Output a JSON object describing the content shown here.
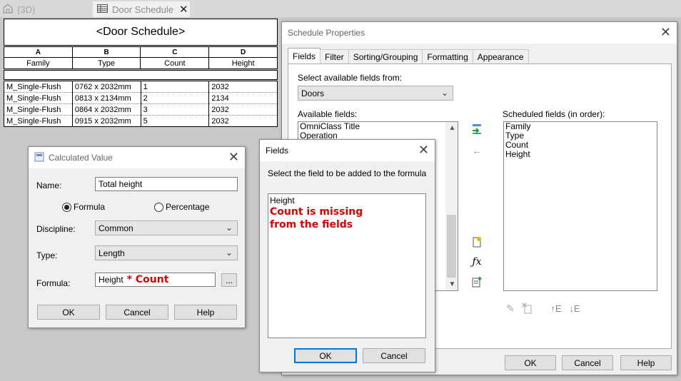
{
  "tabs": [
    {
      "label": "{3D}"
    },
    {
      "label": "Door Schedule"
    }
  ],
  "schedule": {
    "title": "<Door Schedule>",
    "letters": [
      "A",
      "B",
      "C",
      "D"
    ],
    "headers": [
      "Family",
      "Type",
      "Count",
      "Height"
    ],
    "rows": [
      [
        "M_Single-Flush",
        "0762 x 2032mm",
        "1",
        "2032"
      ],
      [
        "M_Single-Flush",
        "0813 x 2134mm",
        "2",
        "2134"
      ],
      [
        "M_Single-Flush",
        "0864 x 2032mm",
        "3",
        "2032"
      ],
      [
        "M_Single-Flush",
        "0915 x 2032mm",
        "5",
        "2032"
      ]
    ]
  },
  "props": {
    "title": "Schedule Properties",
    "tabs": [
      "Fields",
      "Filter",
      "Sorting/Grouping",
      "Formatting",
      "Appearance"
    ],
    "select_label": "Select available fields from:",
    "select_value": "Doors",
    "available_label": "Available fields:",
    "available_items": [
      "OmniClass Title",
      "Operation"
    ],
    "scheduled_label": "Scheduled fields (in order):",
    "scheduled_items": [
      "Family",
      "Type",
      "Count",
      "Height"
    ],
    "ok": "OK",
    "cancel": "Cancel",
    "help": "Help"
  },
  "calc": {
    "title": "Calculated Value",
    "name_label": "Name:",
    "name_value": "Total height",
    "formula_radio": "Formula",
    "percentage_radio": "Percentage",
    "discipline_label": "Discipline:",
    "discipline_value": "Common",
    "type_label": "Type:",
    "type_value": "Length",
    "formula_label": "Formula:",
    "formula_value": "Height",
    "formula_annotation": "* Count",
    "browse": "...",
    "ok": "OK",
    "cancel": "Cancel",
    "help": "Help"
  },
  "fields_dialog": {
    "title": "Fields",
    "prompt": "Select the field to be added to the formula",
    "items": [
      "Height"
    ],
    "annotation_line1": "Count is missing",
    "annotation_line2": "from the fields",
    "ok": "OK",
    "cancel": "Cancel"
  },
  "icons": {
    "3d_view": "house-cube-icon",
    "schedule_tab": "table-icon",
    "add_param": "add-parameter-icon",
    "remove_param": "remove-parameter-icon",
    "new_param": "new-parameter-icon",
    "calc_value": "fx-icon",
    "combine": "combine-parameters-icon",
    "edit": "pencil-icon",
    "delete": "delete-parameter-icon",
    "move_up": "move-up-icon",
    "move_down": "move-down-icon"
  },
  "colors": {
    "annotation_red": "#e00000",
    "default_button_border": "#0078d7"
  }
}
